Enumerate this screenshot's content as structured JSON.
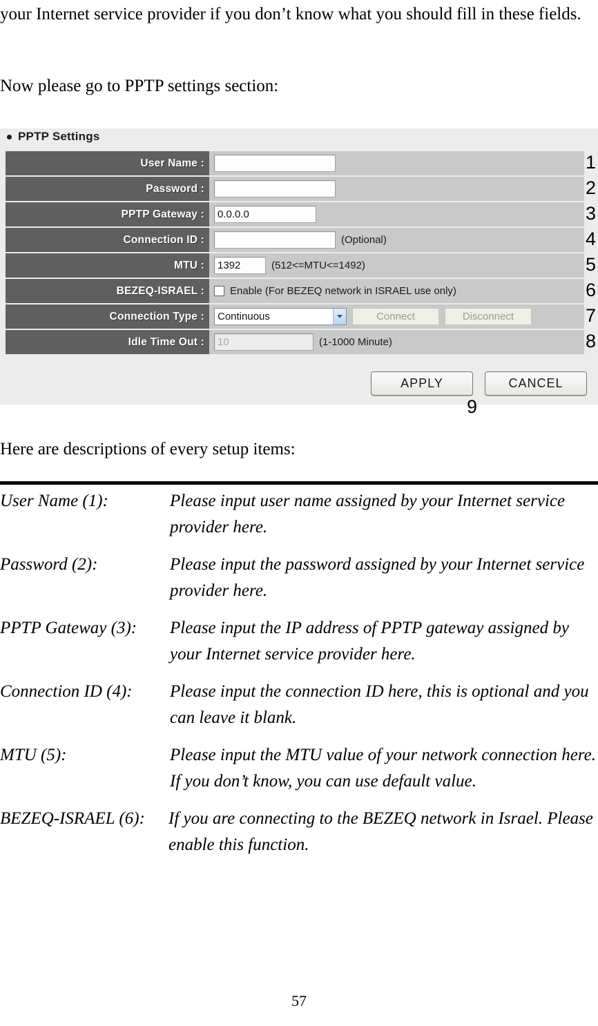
{
  "document": {
    "intro_paragraph": "your Internet service provider if you don’t know what you should fill in these fields.",
    "now_paragraph": "Now please go to PPTP settings section:",
    "here_paragraph": "Here are descriptions of every setup items:",
    "page_number": "57"
  },
  "panel": {
    "section_title": "PPTP Settings",
    "rows": [
      {
        "label": "User Name :",
        "value": "",
        "hint": "",
        "callout": "1"
      },
      {
        "label": "Password :",
        "value": "",
        "hint": "",
        "callout": "2"
      },
      {
        "label": "PPTP Gateway :",
        "value": "0.0.0.0",
        "hint": "",
        "callout": "3"
      },
      {
        "label": "Connection ID :",
        "value": "",
        "hint": "(Optional)",
        "callout": "4"
      },
      {
        "label": "MTU :",
        "value": "1392",
        "hint": "(512<=MTU<=1492)",
        "callout": "5"
      },
      {
        "label": "BEZEQ-ISRAEL :",
        "checkbox_label": "Enable (For BEZEQ network in ISRAEL use only)",
        "checked": false,
        "callout": "6"
      },
      {
        "label": "Connection Type :",
        "selected_option": "Continuous",
        "options": [
          "Continuous"
        ],
        "connect_label": "Connect",
        "disconnect_label": "Disconnect",
        "callout": "7"
      },
      {
        "label": "Idle Time Out :",
        "value": "10",
        "hint": "(1-1000 Minute)",
        "callout": "8"
      }
    ],
    "apply_label": "APPLY",
    "cancel_label": "CANCEL",
    "actions_callout": "9",
    "colors": {
      "panel_background": "#ececec",
      "label_cell": "#5f5f5f",
      "value_cell": "#c9c9c9",
      "input_background": "#fdfdfd",
      "disabled_text": "#a8a8a8"
    }
  },
  "descriptions": [
    {
      "term": "User Name (1):",
      "definition": "Please input user name assigned by your Internet service provider here."
    },
    {
      "term": "Password (2):",
      "definition": "Please input the password assigned by your Internet service provider here."
    },
    {
      "term": "PPTP Gateway (3):",
      "definition": "Please input the IP address of PPTP gateway assigned by your Internet service provider here."
    },
    {
      "term": "Connection ID (4):",
      "definition": "Please input the connection ID here, this is optional and you can leave it blank."
    },
    {
      "term": "MTU (5):",
      "definition": "Please input the MTU value of your network connection here. If you don’t know, you can use default value."
    },
    {
      "term": "BEZEQ-ISRAEL (6):",
      "definition": "If you are connecting to the BEZEQ network in Israel. Please enable this function."
    }
  ]
}
